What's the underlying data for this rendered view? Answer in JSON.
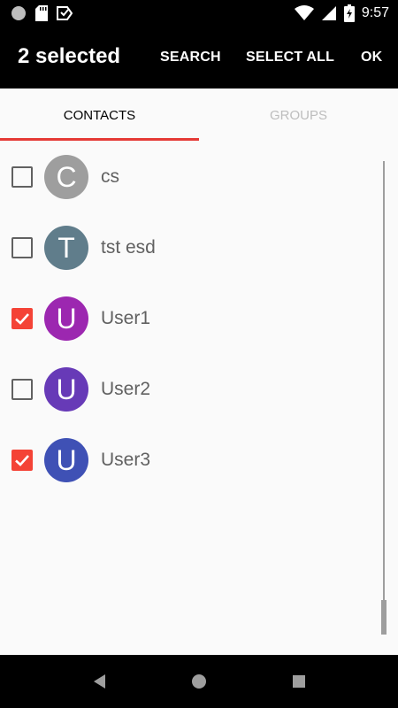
{
  "status_bar": {
    "time": "9:57",
    "icons": [
      "circle-notification-icon",
      "sd-card-icon",
      "vpn-key-icon",
      "wifi-icon",
      "signal-icon",
      "battery-icon"
    ]
  },
  "app_bar": {
    "title": "2 selected",
    "actions": {
      "search": "SEARCH",
      "select_all": "SELECT ALL",
      "ok": "OK"
    }
  },
  "tabs": [
    {
      "label": "CONTACTS",
      "active": true
    },
    {
      "label": "GROUPS",
      "active": false
    }
  ],
  "colors": {
    "accent": "#f44336",
    "tab_indicator": "#e53935"
  },
  "contacts": [
    {
      "initial": "C",
      "name": "cs",
      "checked": false,
      "avatar_color": "#9e9e9e"
    },
    {
      "initial": "T",
      "name": "tst esd",
      "checked": false,
      "avatar_color": "#607d8b"
    },
    {
      "initial": "U",
      "name": "User1",
      "checked": true,
      "avatar_color": "#9c27b0"
    },
    {
      "initial": "U",
      "name": "User2",
      "checked": false,
      "avatar_color": "#673ab7"
    },
    {
      "initial": "U",
      "name": "User3",
      "checked": true,
      "avatar_color": "#3f51b5"
    }
  ],
  "nav_bar": {
    "icons": [
      "back-icon",
      "home-icon",
      "recents-icon"
    ]
  }
}
